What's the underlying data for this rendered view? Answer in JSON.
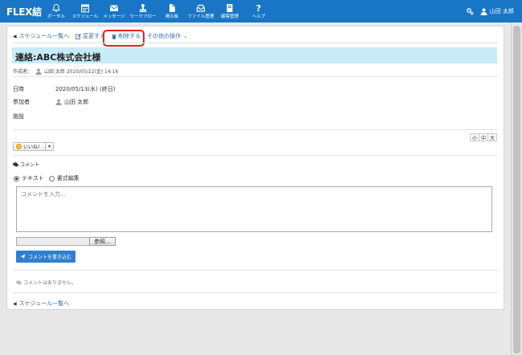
{
  "app": {
    "logo": "FLEX結"
  },
  "nav": [
    {
      "label": "ポータル",
      "icon": "bell-icon"
    },
    {
      "label": "スケジュール",
      "icon": "calendar-icon"
    },
    {
      "label": "メッセージ",
      "icon": "envelope-icon"
    },
    {
      "label": "ワークフロー",
      "icon": "stamp-icon"
    },
    {
      "label": "掲示板",
      "icon": "document-icon"
    },
    {
      "label": "ファイル管理",
      "icon": "tray-icon"
    },
    {
      "label": "顧客管理",
      "icon": "book-icon"
    },
    {
      "label": "ヘルプ",
      "icon": "question-icon"
    }
  ],
  "user": {
    "name": "山田 太郎"
  },
  "actions": {
    "back": "スケジュール一覧へ",
    "edit": "変更する",
    "delete": "削除する",
    "other": "その他の操作"
  },
  "event": {
    "title": "連絡:ABC株式会社様",
    "author_label": "作成者：",
    "author": "山田 太郎 2020/05/22(金) 14:16",
    "date_label": "日時",
    "date_value": "2020/05/13(水) (終日)",
    "attendees_label": "参加者",
    "attendee": "山田 太郎",
    "facility_label": "施設"
  },
  "font_sizes": [
    "小",
    "中",
    "大"
  ],
  "like": {
    "label": "いいね！",
    "caret": "▾"
  },
  "comment": {
    "heading": "コメント",
    "mode_text": "テキスト",
    "mode_rich": "書式編集",
    "placeholder": "コメントを入力...",
    "browse": "参照...",
    "submit": "コメントを書き込む",
    "empty": "コメントはありません。"
  },
  "footer": {
    "back": "スケジュール一覧へ"
  },
  "colors": {
    "header": "#1976c6",
    "link": "#3a6fb0",
    "title_bg": "#c8ebf8",
    "highlight": "#e02020"
  }
}
